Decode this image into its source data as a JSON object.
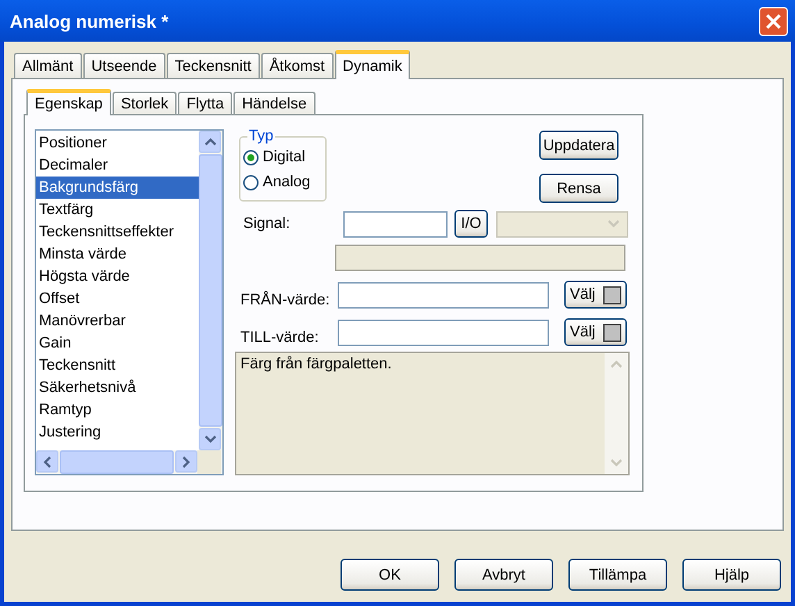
{
  "window": {
    "title": "Analog numerisk *"
  },
  "tabs": [
    {
      "label": "Allmänt",
      "selected": false
    },
    {
      "label": "Utseende",
      "selected": false
    },
    {
      "label": "Teckensnitt",
      "selected": false
    },
    {
      "label": "Åtkomst",
      "selected": false
    },
    {
      "label": "Dynamik",
      "selected": true
    }
  ],
  "subtabs": [
    {
      "label": "Egenskap",
      "selected": true
    },
    {
      "label": "Storlek",
      "selected": false
    },
    {
      "label": "Flytta",
      "selected": false
    },
    {
      "label": "Händelse",
      "selected": false
    }
  ],
  "properties": [
    {
      "label": "Positioner",
      "selected": false
    },
    {
      "label": "Decimaler",
      "selected": false
    },
    {
      "label": "Bakgrundsfärg",
      "selected": true
    },
    {
      "label": "Textfärg",
      "selected": false
    },
    {
      "label": "Teckensnittseffekter",
      "selected": false
    },
    {
      "label": "Minsta värde",
      "selected": false
    },
    {
      "label": "Högsta värde",
      "selected": false
    },
    {
      "label": "Offset",
      "selected": false
    },
    {
      "label": "Manövrerbar",
      "selected": false
    },
    {
      "label": "Gain",
      "selected": false
    },
    {
      "label": "Teckensnitt",
      "selected": false
    },
    {
      "label": "Säkerhetsnivå",
      "selected": false
    },
    {
      "label": "Ramtyp",
      "selected": false
    },
    {
      "label": "Justering",
      "selected": false
    }
  ],
  "type_group": {
    "label": "Typ",
    "options": [
      {
        "label": "Digital",
        "selected": true
      },
      {
        "label": "Analog",
        "selected": false
      }
    ]
  },
  "side_buttons": [
    "Uppdatera",
    "Rensa"
  ],
  "signal": {
    "label": "Signal:",
    "io_button": "I/O",
    "dropdown_disabled": true
  },
  "from": {
    "label": "FRÅN-värde:",
    "button": "Välj"
  },
  "to": {
    "label": "TILL-värde:",
    "button": "Välj"
  },
  "description": "Färg från färgpaletten.",
  "footer_buttons": [
    "OK",
    "Avbryt",
    "Tillämpa",
    "Hjälp"
  ]
}
